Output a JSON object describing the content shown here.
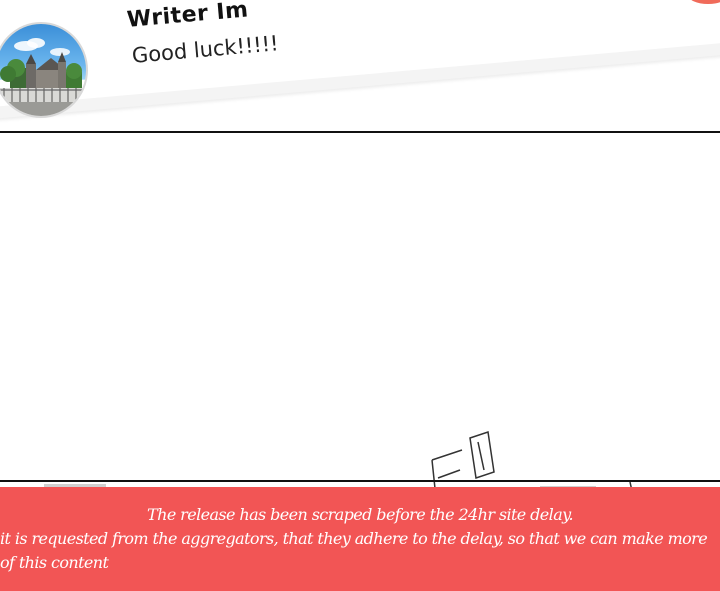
{
  "author_note": {
    "writer_name": "Writer Im",
    "message": "Good luck!!!!!"
  },
  "notice_banner": {
    "line1": "The release has been scraped before the 24hr site delay.",
    "line2": "it is requested from the aggregators, that they adhere to the delay, so that we can make more of this content",
    "background_color": "#f25555",
    "text_color": "#ffffff"
  }
}
